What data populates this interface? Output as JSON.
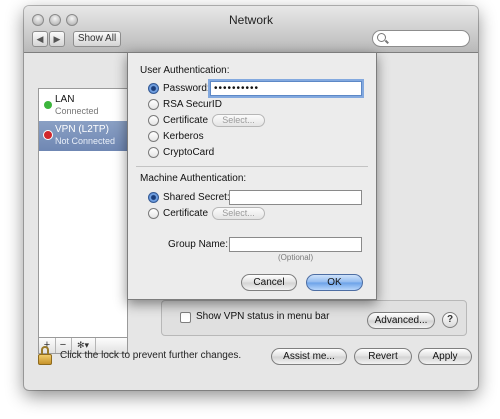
{
  "window": {
    "title": "Network",
    "show_all_label": "Show All",
    "back_glyph": "◀",
    "forward_glyph": "▶"
  },
  "services": [
    {
      "name": "LAN",
      "status": "Connected",
      "color": "#3cb53c"
    },
    {
      "name": "VPN (L2TP)",
      "status": "Not Connected",
      "color": "#d0262b"
    }
  ],
  "sidebar_tools": {
    "add": "+",
    "remove": "−",
    "action": "✻▾"
  },
  "lock": {
    "text": "Click the lock to prevent further changes."
  },
  "footer_buttons": {
    "assist": "Assist me...",
    "revert": "Revert",
    "apply": "Apply"
  },
  "panel": {
    "show_vpn_status_label": "Show VPN status in menu bar",
    "advanced_label": "Advanced...",
    "help_glyph": "?"
  },
  "sheet": {
    "user_auth_heading": "User Authentication:",
    "password_label": "Password:",
    "password_value": "••••••••••",
    "rsa_label": "RSA SecurID",
    "certificate_label": "Certificate",
    "select_label": "Select...",
    "kerberos_label": "Kerberos",
    "cryptocard_label": "CryptoCard",
    "machine_auth_heading": "Machine Authentication:",
    "shared_secret_label": "Shared Secret:",
    "machine_certificate_label": "Certificate",
    "machine_select_label": "Select...",
    "group_name_label": "Group Name:",
    "optional_hint": "(Optional)",
    "cancel_label": "Cancel",
    "ok_label": "OK"
  }
}
